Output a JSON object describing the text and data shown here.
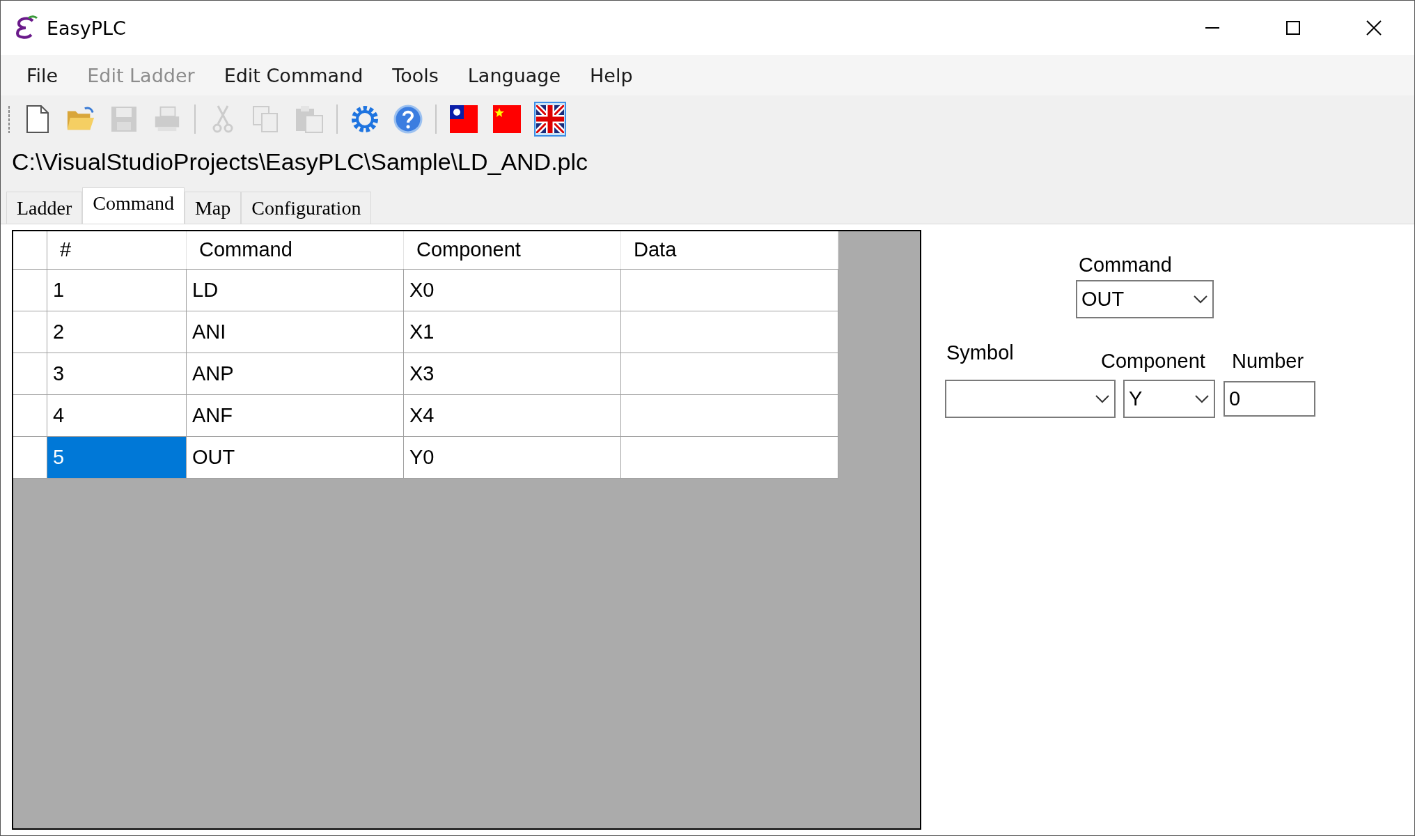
{
  "window": {
    "title": "EasyPLC"
  },
  "menu": [
    {
      "label": "File",
      "disabled": false
    },
    {
      "label": "Edit Ladder",
      "disabled": true
    },
    {
      "label": "Edit Command",
      "disabled": false
    },
    {
      "label": "Tools",
      "disabled": false
    },
    {
      "label": "Language",
      "disabled": false
    },
    {
      "label": "Help",
      "disabled": false
    }
  ],
  "toolbar": [
    {
      "kind": "new",
      "disabled": false
    },
    {
      "kind": "open",
      "disabled": false
    },
    {
      "kind": "save",
      "disabled": true
    },
    {
      "kind": "print",
      "disabled": true
    },
    {
      "kind": "separator"
    },
    {
      "kind": "cut",
      "disabled": true
    },
    {
      "kind": "copy",
      "disabled": true
    },
    {
      "kind": "paste",
      "disabled": true
    },
    {
      "kind": "separator"
    },
    {
      "kind": "settings",
      "disabled": false
    },
    {
      "kind": "help",
      "disabled": false
    },
    {
      "kind": "separator"
    },
    {
      "kind": "flag_tw",
      "selected": false
    },
    {
      "kind": "flag_cn",
      "selected": false
    },
    {
      "kind": "flag_uk",
      "selected": true
    }
  ],
  "path": "C:\\VisualStudioProjects\\EasyPLC\\Sample\\LD_AND.plc",
  "tabs": [
    {
      "label": "Ladder",
      "selected": false
    },
    {
      "label": "Command",
      "selected": true
    },
    {
      "label": "Map",
      "selected": false
    },
    {
      "label": "Configuration",
      "selected": false
    }
  ],
  "table": {
    "columns": [
      "#",
      "Command",
      "Component",
      "Data"
    ],
    "rows": [
      {
        "cells": [
          "1",
          "LD",
          "X0",
          ""
        ],
        "selected": false
      },
      {
        "cells": [
          "2",
          "ANI",
          "X1",
          ""
        ],
        "selected": false
      },
      {
        "cells": [
          "3",
          "ANP",
          "X3",
          ""
        ],
        "selected": false
      },
      {
        "cells": [
          "4",
          "ANF",
          "X4",
          ""
        ],
        "selected": false
      },
      {
        "cells": [
          "5",
          "OUT",
          "Y0",
          ""
        ],
        "selected": true
      }
    ]
  },
  "editor": {
    "command": {
      "label": "Command",
      "value": "OUT"
    },
    "symbol": {
      "label": "Symbol"
    },
    "component": {
      "label": "Component",
      "value": "Y"
    },
    "number": {
      "label": "Number",
      "value": "0"
    }
  }
}
